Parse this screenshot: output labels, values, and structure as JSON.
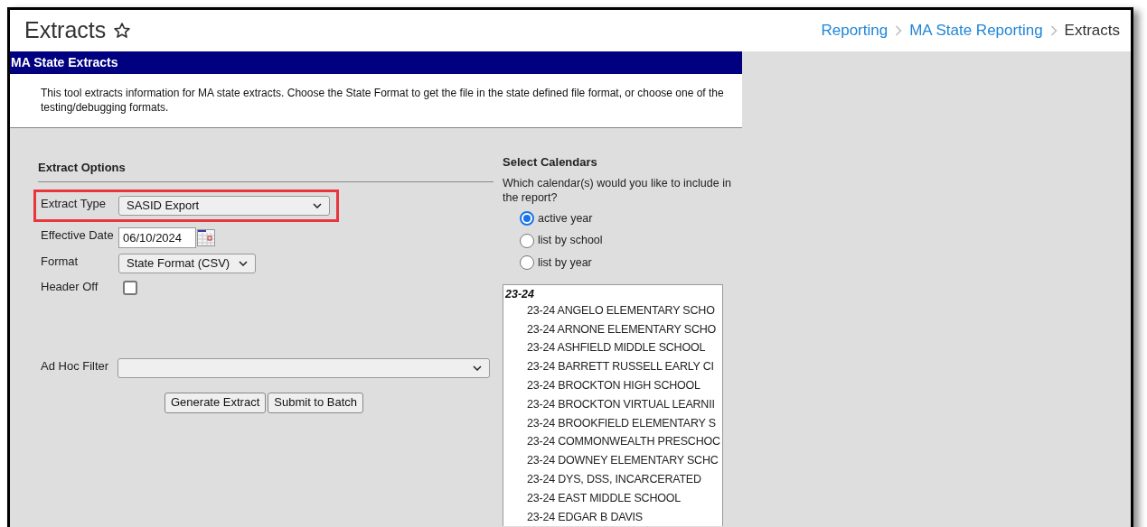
{
  "page": {
    "title": "Extracts",
    "favorite": false
  },
  "breadcrumb": [
    {
      "label": "Reporting",
      "kind": "link"
    },
    {
      "label": "MA State Reporting",
      "kind": "link"
    },
    {
      "label": "Extracts",
      "kind": "current"
    }
  ],
  "panel": {
    "title": "MA State Extracts",
    "description": "This tool extracts information for MA state extracts. Choose the State Format to get the file in the state defined file format, or choose one of the testing/debugging formats."
  },
  "extract_options": {
    "heading": "Extract Options",
    "fields": [
      {
        "kind": "select",
        "label": "Extract Type",
        "value": "SASID Export",
        "highlighted": true
      },
      {
        "kind": "date",
        "label": "Effective Date",
        "value": "06/10/2024"
      },
      {
        "kind": "select",
        "label": "Format",
        "value": "State Format (CSV)",
        "highlighted": false
      },
      {
        "kind": "checkbox",
        "label": "Header Off",
        "checked": false
      },
      {
        "kind": "wide-select",
        "label": "Ad Hoc Filter",
        "highlighted": false
      }
    ],
    "buttons": [
      "Generate Extract",
      "Submit to Batch"
    ]
  },
  "select_calendars": {
    "heading": "Select Calendars",
    "question": "Which calendar(s) would you like to include in the report?",
    "options": [
      {
        "label": "active year",
        "selected": true
      },
      {
        "label": "list by school",
        "selected": false
      },
      {
        "label": "list by year",
        "selected": false
      }
    ],
    "calendars": [
      {
        "label": "23-24",
        "children": [
          {
            "label": "23-24 ANGELO ELEMENTARY SCHO",
            "selected": false
          },
          {
            "label": "23-24 ARNONE ELEMENTARY SCHO",
            "selected": false
          },
          {
            "label": "23-24 ASHFIELD MIDDLE SCHOOL",
            "selected": false
          },
          {
            "label": "23-24 BARRETT RUSSELL EARLY CI",
            "selected": false
          },
          {
            "label": "23-24 BROCKTON HIGH SCHOOL",
            "selected": false
          },
          {
            "label": "23-24 BROCKTON VIRTUAL LEARNII",
            "selected": false
          },
          {
            "label": "23-24 BROOKFIELD ELEMENTARY S",
            "selected": false
          },
          {
            "label": "23-24 COMMONWEALTH PRESCHOC",
            "selected": false
          },
          {
            "label": "23-24 DOWNEY ELEMENTARY SCHC",
            "selected": false
          },
          {
            "label": "23-24 DYS, DSS, INCARCERATED",
            "selected": false
          },
          {
            "label": "23-24 EAST MIDDLE SCHOOL",
            "selected": false
          },
          {
            "label": "23-24 EDGAR B DAVIS",
            "selected": false
          }
        ]
      }
    ]
  }
}
